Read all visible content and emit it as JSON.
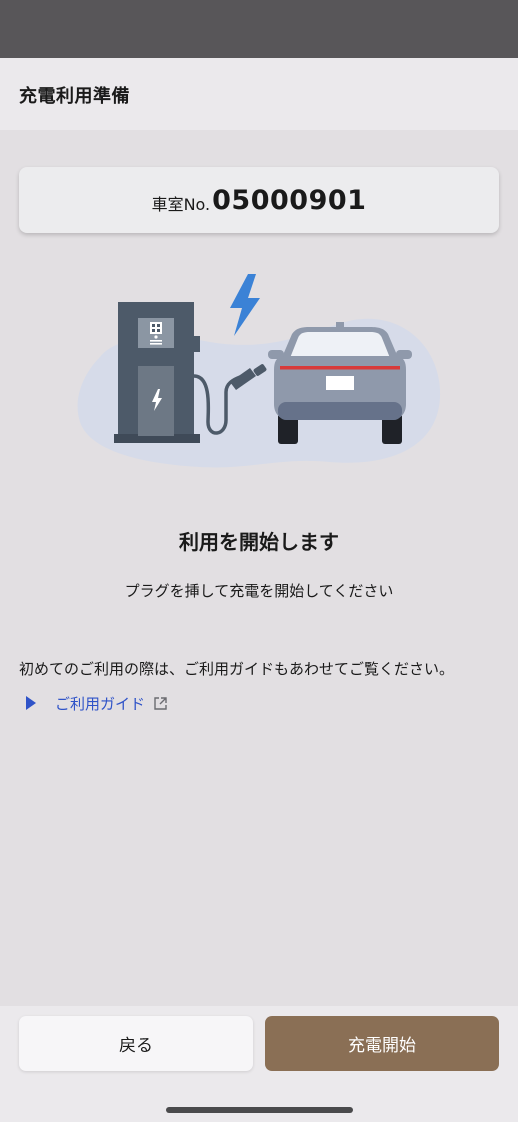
{
  "header": {
    "title": "充電利用準備"
  },
  "car": {
    "prefix": "車室No.",
    "number": "05000901"
  },
  "main": {
    "heading": "利用を開始します",
    "instruction": "プラグを挿して充電を開始してください",
    "notice": "初めてのご利用の際は、ご利用ガイドもあわせてご覧ください。",
    "guide_link_label": "ご利用ガイド"
  },
  "footer": {
    "back_label": "戻る",
    "start_label": "充電開始"
  },
  "colors": {
    "accent_button": "#8a6f55",
    "link": "#2f53c8",
    "lightning": "#3b82d6",
    "charger_body": "#4d5a69",
    "car_body": "#8f99ab",
    "background": "#e2dfe2"
  },
  "icons": [
    "lightning-icon",
    "play-triangle-icon",
    "external-link-icon"
  ]
}
